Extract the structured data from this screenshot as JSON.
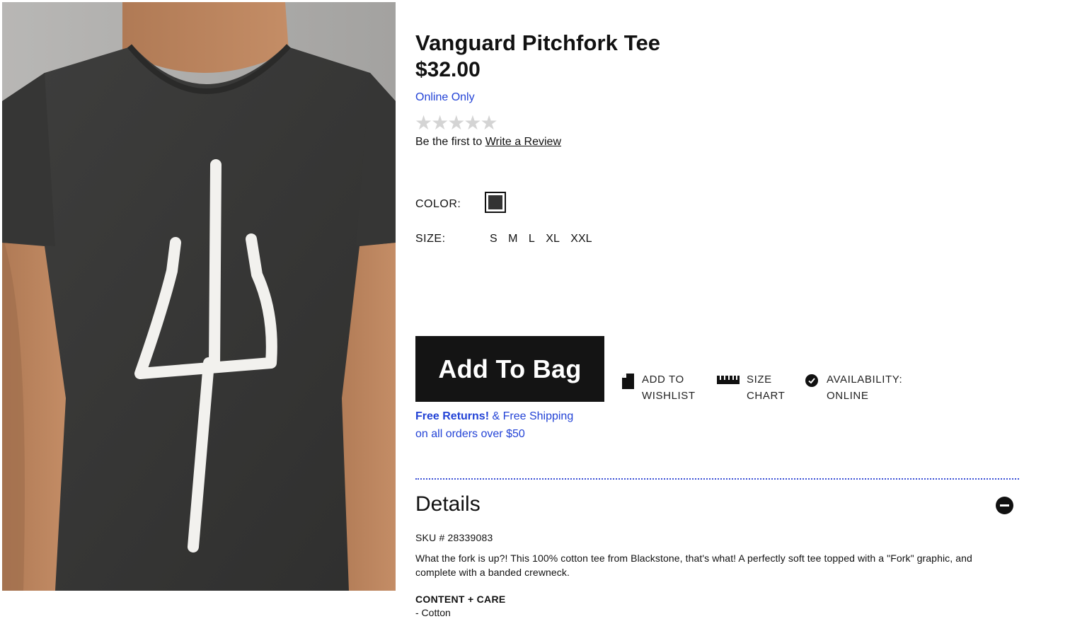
{
  "product": {
    "title": "Vanguard Pitchfork Tee",
    "price": "$32.00",
    "availability_note": "Online Only",
    "rating_stars": 0,
    "rating_max": 5,
    "review_prompt": "Be the first to",
    "review_link": "Write a Review"
  },
  "options": {
    "color_label": "COLOR:",
    "selected_color": "#333333",
    "size_label": "SIZE:",
    "sizes": [
      "S",
      "M",
      "L",
      "XL",
      "XXL"
    ]
  },
  "purchase": {
    "add_to_bag": "Add To Bag",
    "free_returns": "Free Returns!",
    "free_shipping": "& Free Shipping",
    "shipping_condition": "on all orders over $50"
  },
  "actions": {
    "wishlist_line1": "ADD TO",
    "wishlist_line2": "WISHLIST",
    "sizechart_line1": "SIZE",
    "sizechart_line2": "CHART",
    "availability_line1": "AVAILABILITY:",
    "availability_line2": "ONLINE"
  },
  "details": {
    "heading": "Details",
    "sku": "SKU # 28339083",
    "description": "What the fork is up?! This 100% cotton tee from Blackstone, that's what! A perfectly soft tee topped with a \"Fork\" graphic, and complete with a banded crewneck.",
    "care_heading": "CONTENT + CARE",
    "care_items": [
      "- Cotton"
    ]
  },
  "colors": {
    "link_blue": "#2343d6",
    "button_black": "#141414",
    "star_grey": "#d4d4d4",
    "shirt": "#3a3a39"
  },
  "icons": {
    "wishlist": "page-fold-icon",
    "sizechart": "ruler-icon",
    "availability": "check-circle-icon",
    "collapse": "minus-circle-icon"
  }
}
